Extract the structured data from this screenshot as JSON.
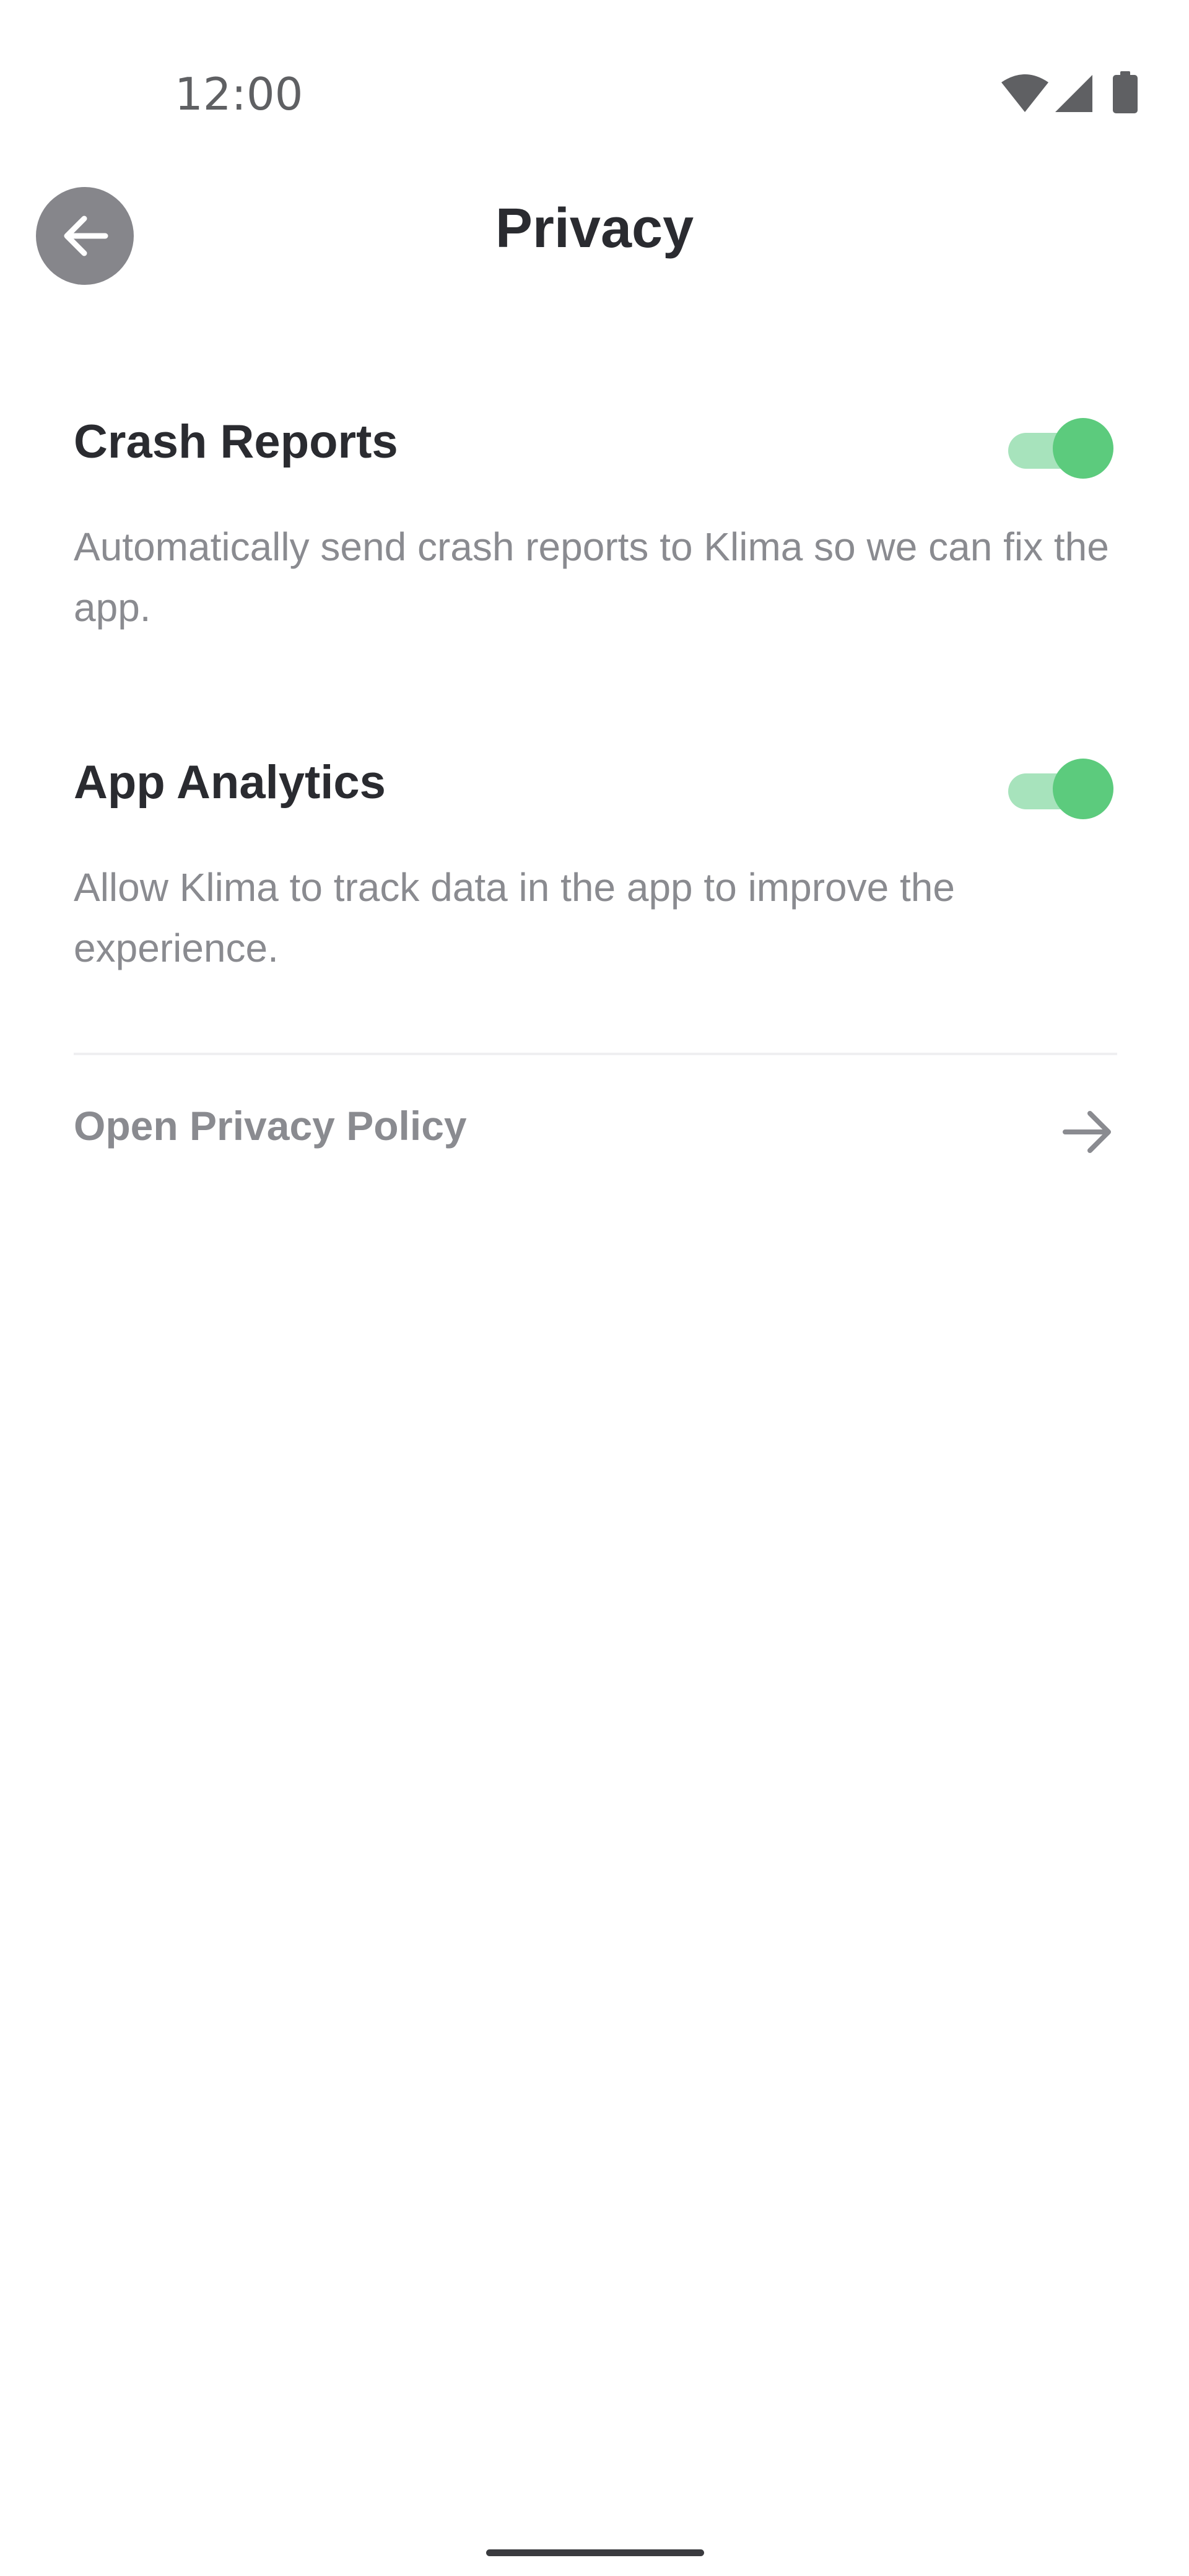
{
  "status_bar": {
    "time": "12:00",
    "icons": [
      "wifi-icon",
      "cellular-signal-icon",
      "battery-icon"
    ]
  },
  "header": {
    "back_icon": "arrow-left-icon",
    "title": "Privacy"
  },
  "settings": [
    {
      "title": "Crash Reports",
      "description": "Automatically send crash reports to Klima so we can fix the app.",
      "enabled": true
    },
    {
      "title": "App Analytics",
      "description": "Allow Klima to track data in the app to improve the experience.",
      "enabled": true
    }
  ],
  "policy_link": {
    "label": "Open Privacy Policy",
    "icon": "arrow-right-icon"
  },
  "colors": {
    "toggle_on_thumb": "#5ccb7d",
    "toggle_on_track": "#a7e3bc",
    "title_text": "#2a2b30",
    "secondary_text": "#8a8b90",
    "back_button_bg": "#86868b"
  }
}
